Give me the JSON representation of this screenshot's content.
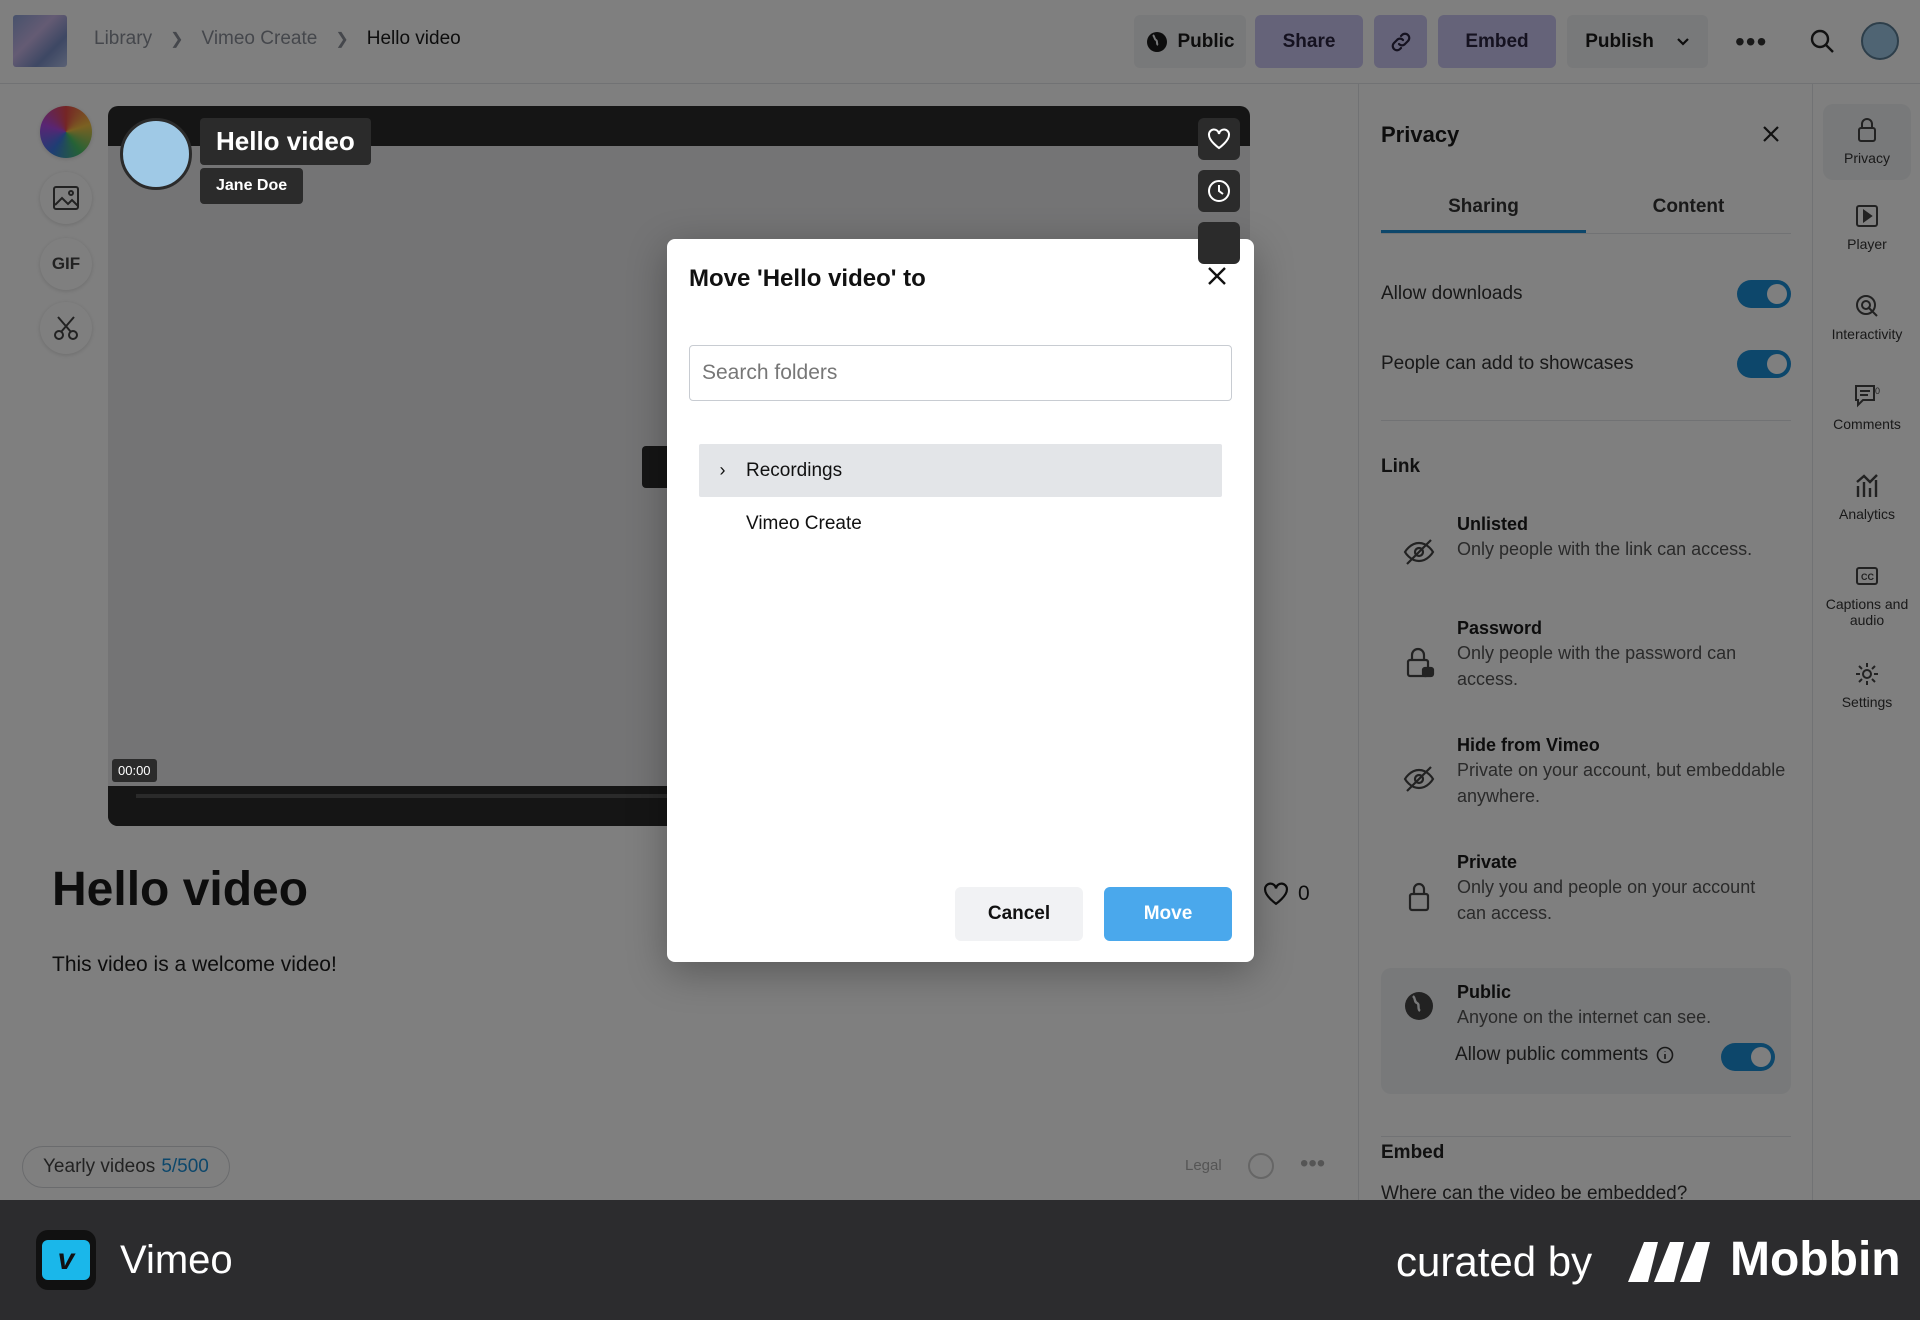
{
  "topbar": {
    "breadcrumb": [
      "Library",
      "Vimeo Create",
      "Hello video"
    ],
    "public_label": "Public",
    "share_label": "Share",
    "embed_label": "Embed",
    "publish_label": "Publish",
    "more_label": "•••"
  },
  "tools": {
    "gif_label": "GIF"
  },
  "player": {
    "title": "Hello video",
    "author": "Jane Doe",
    "timestamp": "00:00"
  },
  "video": {
    "title": "Hello video",
    "description": "This video is a welcome video!",
    "likes": "0"
  },
  "footer_bar": {
    "yearly_label": "Yearly videos",
    "yearly_count": "5/500",
    "legal_label": "Legal"
  },
  "panel": {
    "title": "Privacy",
    "tabs": [
      "Sharing",
      "Content"
    ],
    "active_tab": "Sharing",
    "toggles": [
      {
        "label": "Allow downloads",
        "on": true
      },
      {
        "label": "People can add to showcases",
        "on": true
      }
    ],
    "link_heading": "Link",
    "options": [
      {
        "title": "Unlisted",
        "desc": "Only people with the link can access.",
        "icon": "eye-slash-icon"
      },
      {
        "title": "Password",
        "desc": "Only people with the password can access.",
        "icon": "lock-icon"
      },
      {
        "title": "Hide from Vimeo",
        "desc": "Private on your account, but embeddable anywhere.",
        "icon": "eye-slash-icon"
      },
      {
        "title": "Private",
        "desc": "Only you and people on your account can access.",
        "icon": "lock-icon"
      },
      {
        "title": "Public",
        "desc": "Anyone on the internet can see.",
        "icon": "globe-icon",
        "selected": true
      }
    ],
    "public_comments_label": "Allow public comments",
    "embed_heading": "Embed",
    "embed_question": "Where can the video be embedded?"
  },
  "rail": [
    {
      "label": "Privacy",
      "icon": "lock-icon",
      "active": true
    },
    {
      "label": "Player",
      "icon": "play-square-icon"
    },
    {
      "label": "Interactivity",
      "icon": "cursor-click-icon"
    },
    {
      "label": "Comments",
      "icon": "comment-icon",
      "badge": "0"
    },
    {
      "label": "Analytics",
      "icon": "chart-icon"
    },
    {
      "label": "Captions and audio",
      "icon": "cc-icon"
    },
    {
      "label": "Settings",
      "icon": "gear-icon"
    }
  ],
  "modal": {
    "title": "Move 'Hello video' to",
    "search_placeholder": "Search folders",
    "folders": [
      {
        "name": "Recordings",
        "expandable": true,
        "highlighted": true
      },
      {
        "name": "Vimeo Create",
        "expandable": false,
        "highlighted": false
      }
    ],
    "cancel_label": "Cancel",
    "move_label": "Move"
  },
  "footer": {
    "brand": "Vimeo",
    "curated_by": "curated by",
    "mobbin": "Mobbin"
  },
  "colors": {
    "accent": "#1a8fd6",
    "move_button": "#4aa8ec",
    "purple_button": "#cbc7f2",
    "overlay": "rgba(0,0,0,0.5)",
    "footer_bg": "#2c2c2e"
  }
}
